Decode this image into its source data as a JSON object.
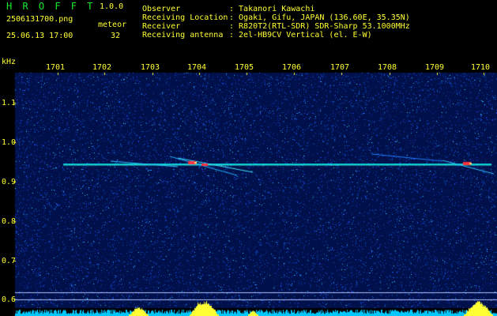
{
  "header": {
    "app_title": "H R O F F T",
    "version": "1.0.0",
    "file_name": "2506131700.png",
    "datetime": "25.06.13 17:00",
    "meteor_label": "meteor",
    "meteor_count": "32",
    "info_labels": [
      "Observer",
      "Receiving Location",
      "Receiver",
      "Receiving antenna"
    ],
    "info_values": [
      ": Takanori Kawachi",
      ": Ogaki, Gifu, JAPAN (136.60E, 35.35N)",
      ": R820T2(RTL-SDR) SDR-Sharp 53.1000MHz",
      ": 2el-HB9CV Vertical (el. E-W)"
    ]
  },
  "axis": {
    "y_unit": "kHz",
    "y_ticks": [
      "1.1",
      "1.0",
      "0.9",
      "0.8",
      "0.7",
      "0.6"
    ],
    "x_ticks": [
      "1701",
      "1702",
      "1703",
      "1704",
      "1705",
      "1706",
      "1707",
      "1708",
      "1709",
      "1710"
    ]
  },
  "colors": {
    "background": "#000000",
    "spectrogram_bg": "#00104a",
    "label_green": "#19e82c",
    "label_yellow": "#ffff33",
    "signal": "#00ffff",
    "meteor_head": "#ff3040",
    "bottom_bar": "#00c8ff",
    "bottom_peak": "#ffff33"
  }
}
